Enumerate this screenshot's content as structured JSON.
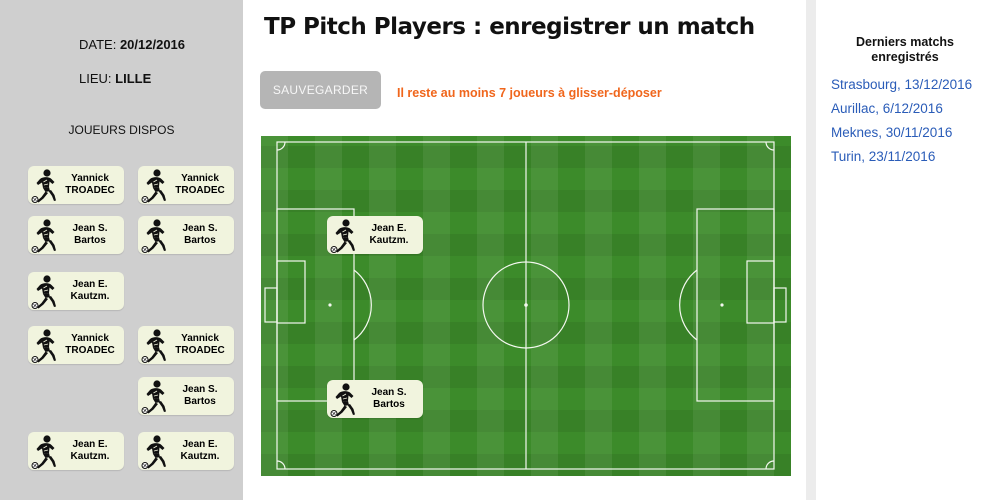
{
  "sidebar": {
    "date_label": "DATE:",
    "date_value": "20/12/2016",
    "lieu_label": "LIEU:",
    "lieu_value": "LILLE",
    "available_title": "JOUEURS DISPOS",
    "players": [
      {
        "first": "Yannick",
        "last": "TROADEC"
      },
      {
        "first": "Yannick",
        "last": "TROADEC"
      },
      {
        "first": "Jean S.",
        "last": "Bartos"
      },
      {
        "first": "Jean S.",
        "last": "Bartos"
      },
      {
        "first": "Jean E.",
        "last": "Kautzm."
      },
      {
        "first": "Yannick",
        "last": "TROADEC"
      },
      {
        "first": "Yannick",
        "last": "TROADEC"
      },
      {
        "first": "Jean S.",
        "last": "Bartos"
      },
      {
        "first": "Jean E.",
        "last": "Kautzm."
      },
      {
        "first": "Jean E.",
        "last": "Kautzm."
      }
    ]
  },
  "main": {
    "title": "TP Pitch Players : enregistrer un match",
    "save_label": "SAUVEGARDER",
    "status_message": "Il reste au moins 7 joueurs à glisser-déposer",
    "pitch_players": [
      {
        "first": "Jean E.",
        "last": "Kautzm."
      },
      {
        "first": "Jean S.",
        "last": "Bartos"
      }
    ]
  },
  "recent": {
    "title_line1": "Derniers matchs",
    "title_line2": "enregistrés",
    "matches": [
      "Strasbourg, 13/12/2016",
      "Aurillac, 6/12/2016",
      "Meknes, 30/11/2016",
      "Turin, 23/11/2016"
    ]
  },
  "colors": {
    "sidebar_bg": "#cfcfcf",
    "card_bg": "#f1f4de",
    "pitch_green": "#3c8b2a",
    "status_orange": "#f0661c",
    "link_blue": "#2a5cb8",
    "save_button_bg": "#b5b5b5"
  },
  "icons": {
    "player_card": "footballer-icon"
  }
}
